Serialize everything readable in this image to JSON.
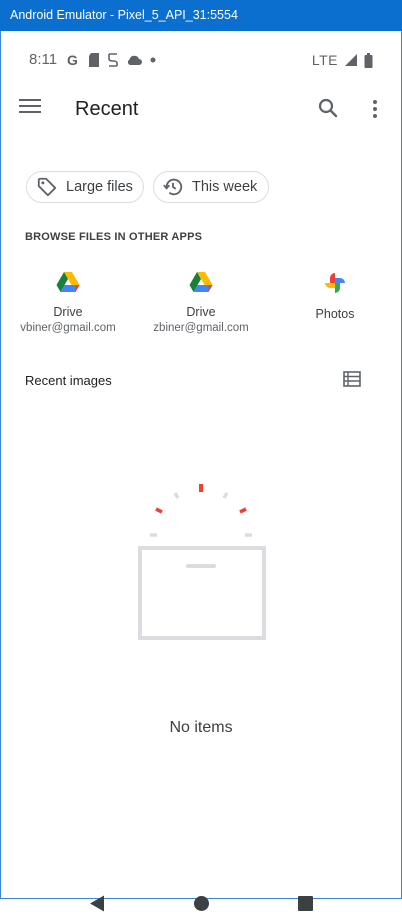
{
  "emulator": {
    "title": "Android Emulator - Pixel_5_API_31:5554"
  },
  "status_bar": {
    "time": "8:11",
    "network": "LTE",
    "left_icons": [
      "google-g-icon",
      "sd-card-icon",
      "storage-icon",
      "cloud-icon",
      "dot-icon"
    ],
    "right_icons": [
      "signal-icon",
      "battery-icon"
    ]
  },
  "header": {
    "title": "Recent",
    "menu_icon": "hamburger-menu-icon",
    "search_icon": "search-icon",
    "more_icon": "more-vert-icon"
  },
  "filters": [
    {
      "label": "Large files",
      "icon": "tag-icon"
    },
    {
      "label": "This week",
      "icon": "history-icon"
    }
  ],
  "browse_section": {
    "title": "BROWSE FILES IN OTHER APPS",
    "apps": [
      {
        "name": "Drive",
        "account": "vbiner@gmail.com",
        "icon": "google-drive-icon"
      },
      {
        "name": "Drive",
        "account": "zbiner@gmail.com",
        "icon": "google-drive-icon"
      },
      {
        "name": "Photos",
        "account": "",
        "icon": "google-photos-icon"
      }
    ]
  },
  "recent_images": {
    "label": "Recent images",
    "view_icon": "list-view-icon"
  },
  "empty_state": {
    "text": "No items"
  },
  "nav_bar": {
    "icons": [
      "back-icon",
      "home-icon",
      "recents-icon"
    ]
  },
  "colors": {
    "titlebar": "#0b6fcf",
    "red_accent": "#ea4335",
    "drive_green": "#188038",
    "drive_yellow": "#fbbc04",
    "drive_blue": "#4285f4"
  }
}
